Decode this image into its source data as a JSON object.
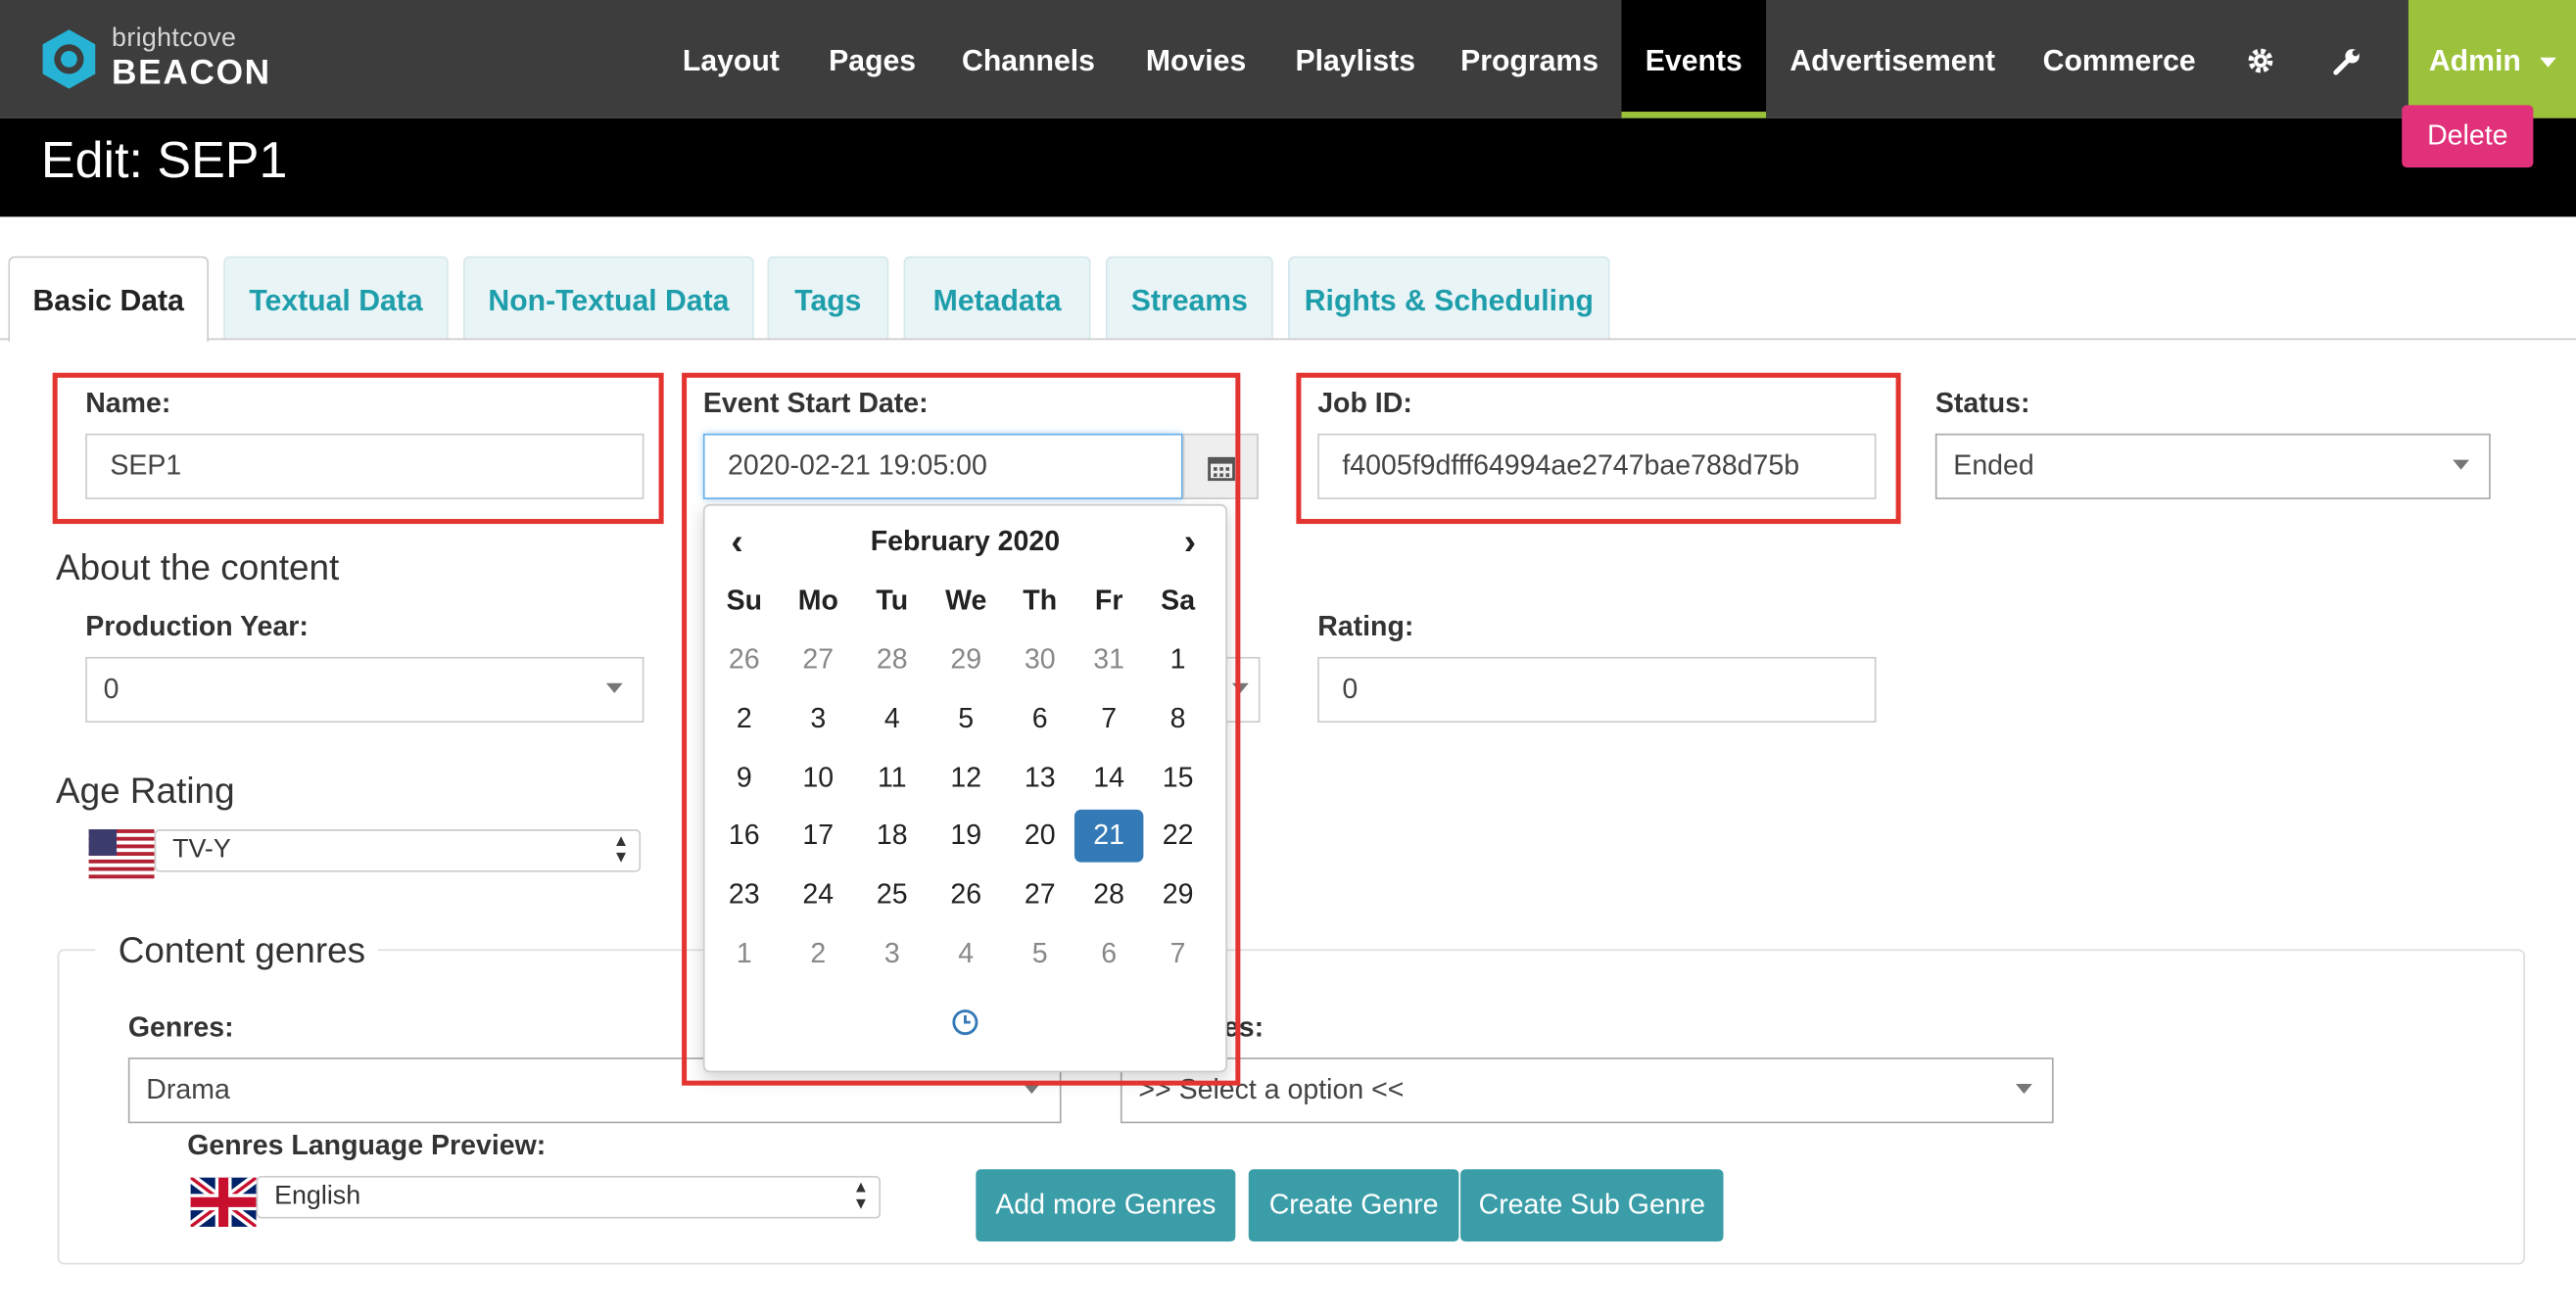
{
  "brand": {
    "small": "brightcove",
    "big": "BEACON"
  },
  "nav": {
    "items": [
      "Layout",
      "Pages",
      "Channels",
      "Movies",
      "Playlists",
      "Programs",
      "Events",
      "Advertisement",
      "Commerce"
    ],
    "active": "Events",
    "admin_label": "Admin"
  },
  "page": {
    "title": "Edit: SEP1",
    "delete_label": "Delete"
  },
  "tabs": [
    "Basic Data",
    "Textual Data",
    "Non-Textual Data",
    "Tags",
    "Metadata",
    "Streams",
    "Rights & Scheduling"
  ],
  "form": {
    "name_label": "Name:",
    "name_value": "SEP1",
    "start_label": "Event Start Date:",
    "start_value": "2020-02-21 19:05:00",
    "jobid_label": "Job ID:",
    "jobid_value": "f4005f9dfff64994ae2747bae788d75b",
    "status_label": "Status:",
    "status_value": "Ended",
    "about_heading": "About the content",
    "prod_year_label": "Production Year:",
    "prod_year_value": "0",
    "rating_label": "Rating:",
    "rating_value": "0",
    "age_heading": "Age Rating",
    "age_value": "TV-Y"
  },
  "genres": {
    "legend": "Content genres",
    "genres_label": "Genres:",
    "genres_value": "Drama",
    "subgenres_label_visible": "res:",
    "subgenres_value": ">> Select a option <<",
    "lang_label": "Genres Language Preview:",
    "lang_value": "English",
    "add_more": "Add more Genres",
    "create_genre": "Create Genre",
    "create_sub": "Create Sub Genre"
  },
  "calendar": {
    "month": "February 2020",
    "dow": [
      "Su",
      "Mo",
      "Tu",
      "We",
      "Th",
      "Fr",
      "Sa"
    ],
    "weeks": [
      [
        "26",
        "27",
        "28",
        "29",
        "30",
        "31",
        "1"
      ],
      [
        "2",
        "3",
        "4",
        "5",
        "6",
        "7",
        "8"
      ],
      [
        "9",
        "10",
        "11",
        "12",
        "13",
        "14",
        "15"
      ],
      [
        "16",
        "17",
        "18",
        "19",
        "20",
        "21",
        "22"
      ],
      [
        "23",
        "24",
        "25",
        "26",
        "27",
        "28",
        "29"
      ],
      [
        "1",
        "2",
        "3",
        "4",
        "5",
        "6",
        "7"
      ]
    ],
    "selected": "21"
  },
  "colors": {
    "accent": "#9bc23a",
    "teal": "#3a9da8",
    "delete": "#e0317a",
    "selected_day": "#337ab7",
    "highlight": "#e3342f"
  }
}
